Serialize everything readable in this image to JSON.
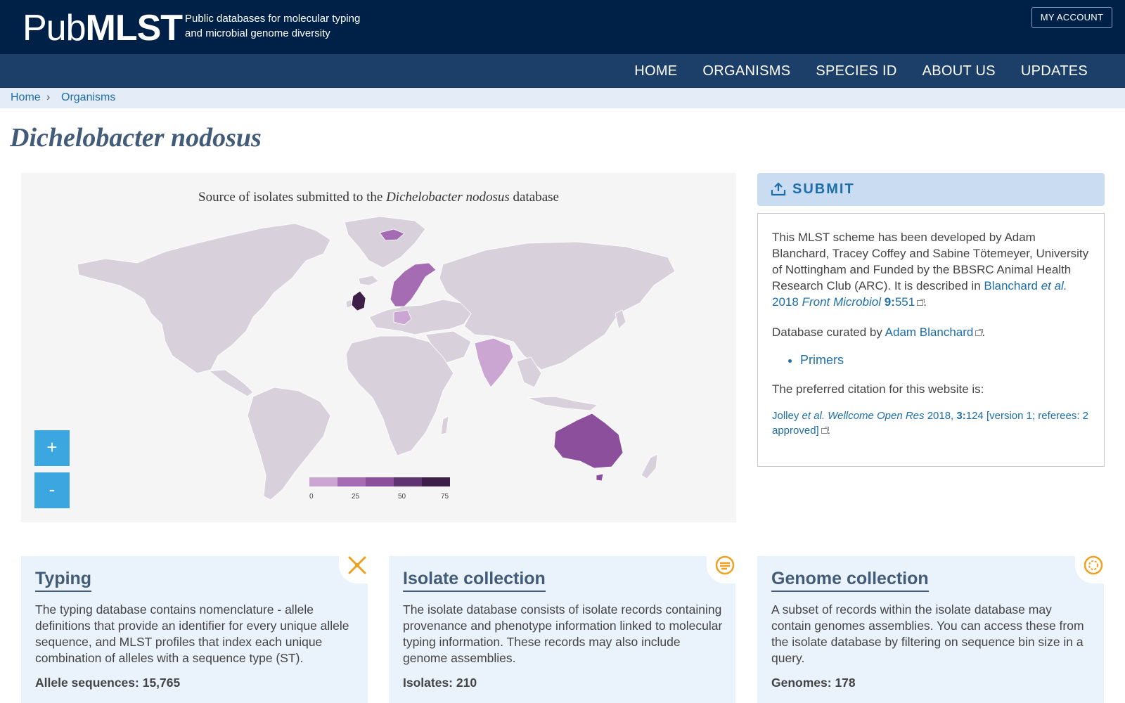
{
  "header": {
    "logo_light": "Pub",
    "logo_bold": "MLST",
    "tagline_line1": "Public databases for molecular typing",
    "tagline_line2": "and microbial genome diversity",
    "account_button": "MY ACCOUNT"
  },
  "nav": {
    "items": [
      "HOME",
      "ORGANISMS",
      "SPECIES ID",
      "ABOUT US",
      "UPDATES"
    ]
  },
  "breadcrumb": {
    "home": "Home",
    "separator": "›",
    "current": "Organisms"
  },
  "page_title": "Dichelobacter nodosus",
  "map": {
    "title_prefix": "Source of isolates submitted to the ",
    "title_organism": "Dichelobacter nodosus",
    "title_suffix": " database",
    "zoom_in": "+",
    "zoom_out": "-",
    "legend_ticks": [
      "0",
      "25",
      "50",
      "75"
    ],
    "colors": {
      "land": "#d8d1dc",
      "low": "#cba6d3",
      "mid": "#a56bb3",
      "high": "#8b4f9c",
      "max": "#3d1f48"
    }
  },
  "submit": {
    "label": "SUBMIT",
    "icon": "upload-icon"
  },
  "info": {
    "p1_text": "This MLST scheme has been developed by Adam Blanchard, Tracey Coffey and Sabine Tötemeyer, University of Nottingham and Funded by the BBSRC Animal Health Research Club (ARC). It is described in ",
    "p1_link_author": "Blanchard",
    "p1_link_etal": "et al.",
    "p1_link_year": "2018",
    "p1_link_journal": "Front Microbiol",
    "p1_link_volume": "9:",
    "p1_link_page": "551",
    "p2_text": "Database curated by ",
    "p2_link": "Adam Blanchard",
    "list_item": "Primers",
    "p3_text": "The preferred citation for this website is:",
    "cite_author": "Jolley",
    "cite_etal": "et al.",
    "cite_journal": "Wellcome Open Res",
    "cite_year": "2018,",
    "cite_volume": "3:",
    "cite_rest": "124 [version 1; referees: 2 approved]"
  },
  "cards": [
    {
      "title": "Typing",
      "icon": "typing-icon",
      "description": "The typing database contains nomenclature - allele definitions that provide an identifier for every unique allele sequence, and MLST profiles that index each unique combination of alleles with a sequence type (ST).",
      "stat": "Allele sequences: 15,765"
    },
    {
      "title": "Isolate collection",
      "icon": "isolate-dish-icon",
      "description": "The isolate database consists of isolate records containing provenance and phenotype information linked to molecular typing information. These records may also include genome assemblies.",
      "stat": "Isolates: 210"
    },
    {
      "title": "Genome collection",
      "icon": "genome-icon",
      "description": "A subset of records within the isolate database may contain genomes assemblies. You can access these from the isolate database by filtering on sequence bin size in a query.",
      "stat": "Genomes: 178"
    }
  ]
}
